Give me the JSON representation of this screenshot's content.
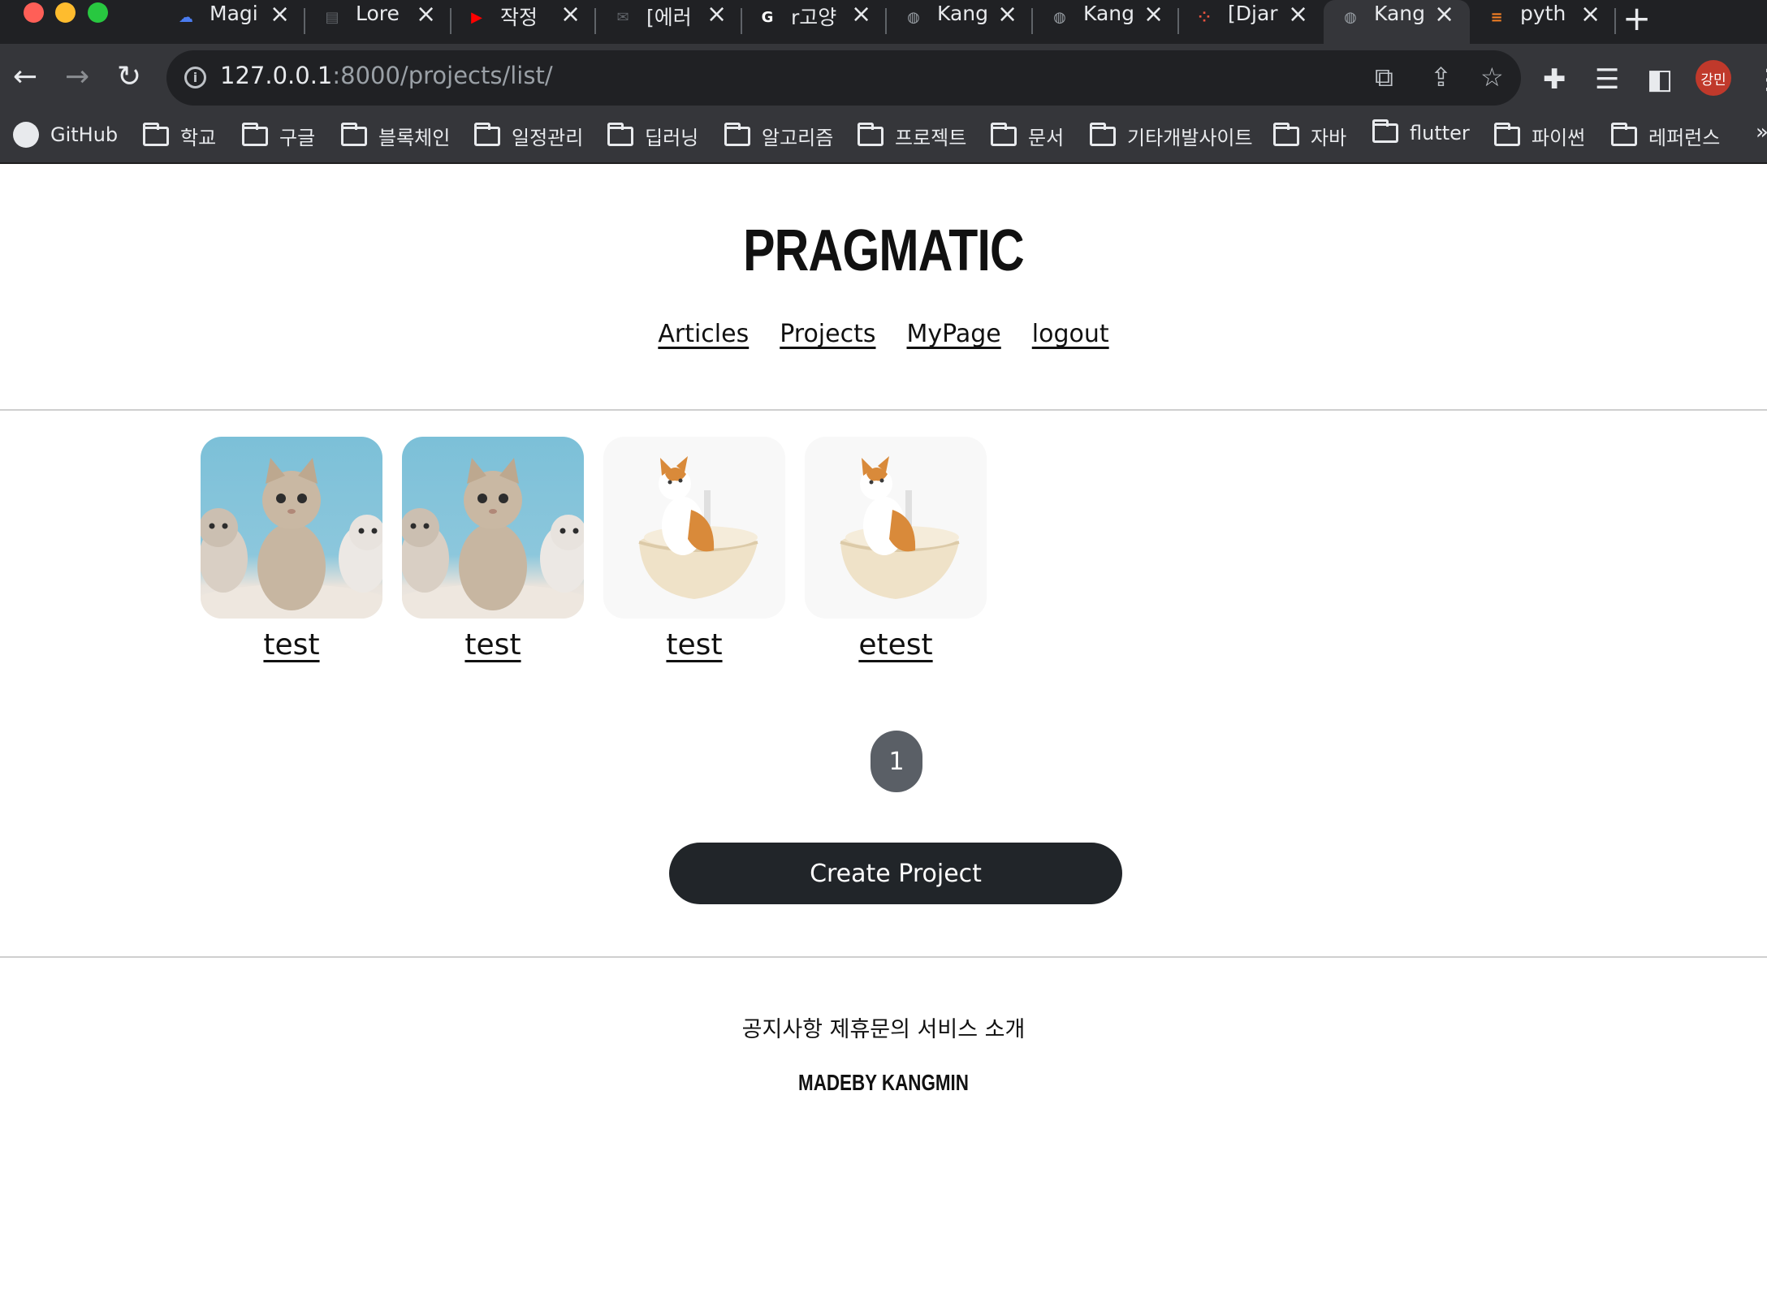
{
  "browser": {
    "tabs": [
      {
        "title": "Magi",
        "icon": "cloud-icon",
        "color": "#4a7cf0"
      },
      {
        "title": "Lore",
        "icon": "page-icon",
        "color": "#5f6368"
      },
      {
        "title": "작정",
        "icon": "youtube-icon",
        "color": "#ff0000"
      },
      {
        "title": "[에러",
        "icon": "chat-icon",
        "color": "#5f6368"
      },
      {
        "title": "r고양",
        "icon": "google-icon",
        "color": "#ffffff"
      },
      {
        "title": "Kang",
        "icon": "globe-icon",
        "color": "#9aa0a6"
      },
      {
        "title": "Kang",
        "icon": "globe-icon",
        "color": "#9aa0a6"
      },
      {
        "title": "[Djar",
        "icon": "dots-icon",
        "color": "#e8533f"
      },
      {
        "title": "Kang",
        "icon": "globe-icon",
        "color": "#9aa0a6"
      },
      {
        "title": "pyth",
        "icon": "stack-icon",
        "color": "#f48024"
      }
    ],
    "active_tab_index": 8,
    "url_host": "127.0.0.1",
    "url_rest": ":8000/projects/list/",
    "profile_initials": "강민",
    "bookmarks": [
      "GitHub",
      "학교",
      "구글",
      "블록체인",
      "일정관리",
      "딥러닝",
      "알고리즘",
      "프로젝트",
      "문서",
      "기타개발사이트",
      "자바",
      "flutter",
      "파이썬",
      "레퍼런스"
    ],
    "bookmarks_more": "»"
  },
  "page": {
    "logo": "PRAGMATIC",
    "nav": [
      "Articles",
      "Projects",
      "MyPage",
      "logout"
    ],
    "projects": [
      {
        "title": "test",
        "image": "kittens-photo"
      },
      {
        "title": "test",
        "image": "kittens-photo"
      },
      {
        "title": "test",
        "image": "cat-in-litter-box-photo"
      },
      {
        "title": "etest",
        "image": "cat-in-litter-box-photo"
      }
    ],
    "pagination": {
      "current": "1"
    },
    "create_button": "Create Project",
    "footer_links": "공지사항 제휴문의 서비스 소개",
    "footer_credit": "MADEBY KANGMIN"
  }
}
